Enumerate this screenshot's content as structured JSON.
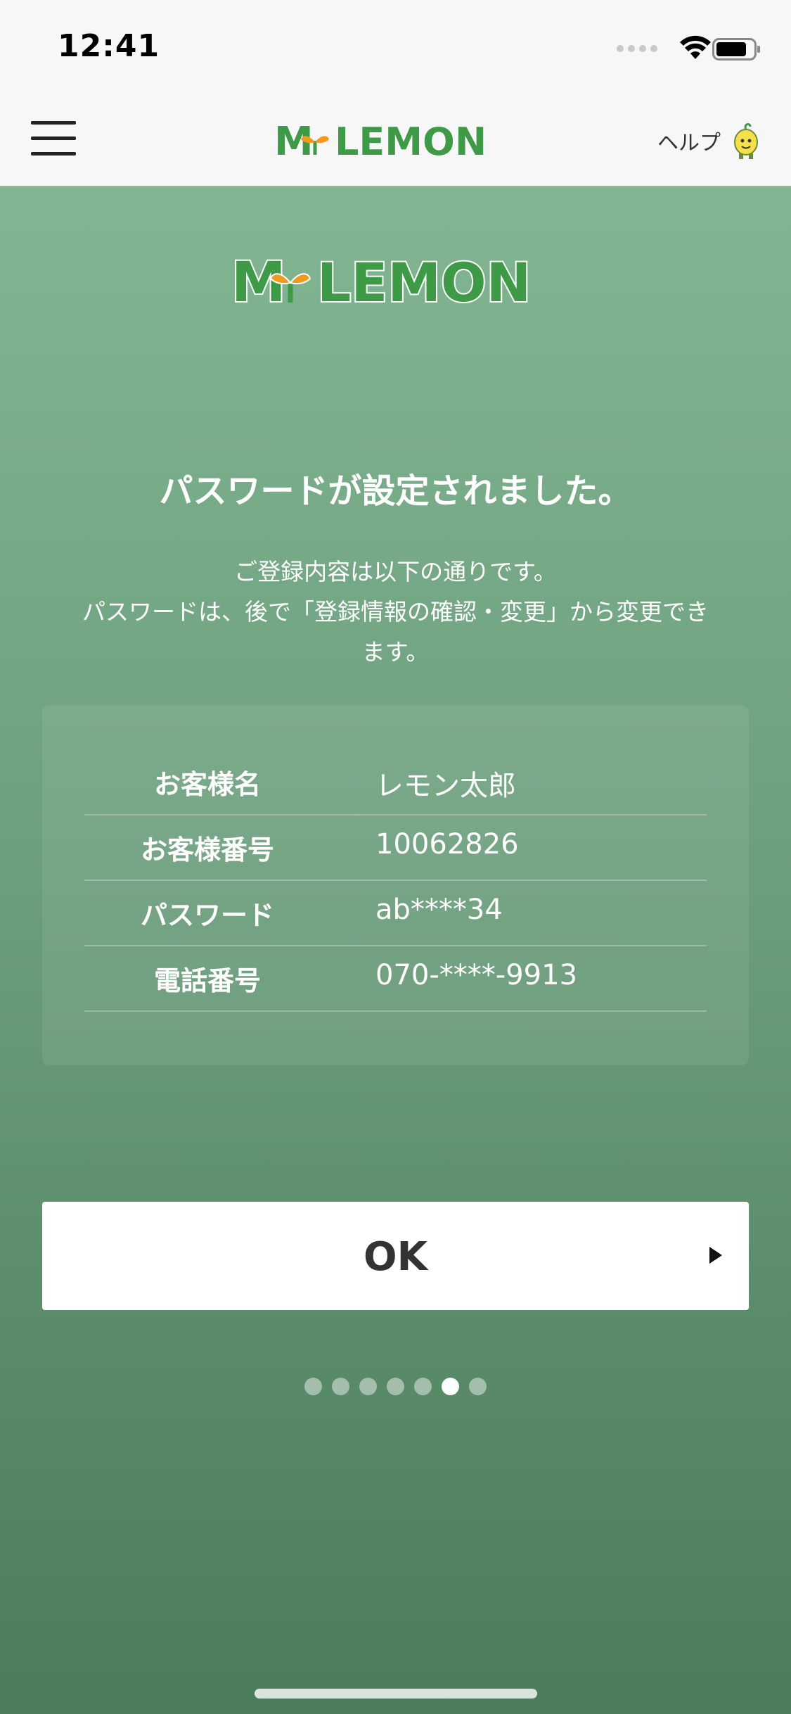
{
  "status_bar": {
    "time": "12:41"
  },
  "header": {
    "logo_text": "MyLEMON",
    "help_label": "ヘルプ",
    "icons": {
      "menu": "hamburger-menu-icon",
      "mascot": "lemon-mascot-icon"
    }
  },
  "main": {
    "logo_text": "MyLEMON",
    "title": "パスワードが設定されました。",
    "description_lines": [
      "ご登録内容は以下の通りです。",
      "パスワードは、後で「登録情報の確認・変更」から変更でき",
      "ます。"
    ],
    "info_rows": [
      {
        "label": "お客様名",
        "value": "レモン太郎"
      },
      {
        "label": "お客様番号",
        "value": "10062826"
      },
      {
        "label": "パスワード",
        "value": "ab****34"
      },
      {
        "label": "電話番号",
        "value": "070-****-9913"
      }
    ],
    "ok_button_label": "OK",
    "pager": {
      "total": 7,
      "active_index": 5
    }
  },
  "colors": {
    "brand_green": "#3f9a48",
    "accent_orange": "#f29a1f",
    "bg_top": "#82b592",
    "bg_bottom": "#4b7c5b"
  }
}
